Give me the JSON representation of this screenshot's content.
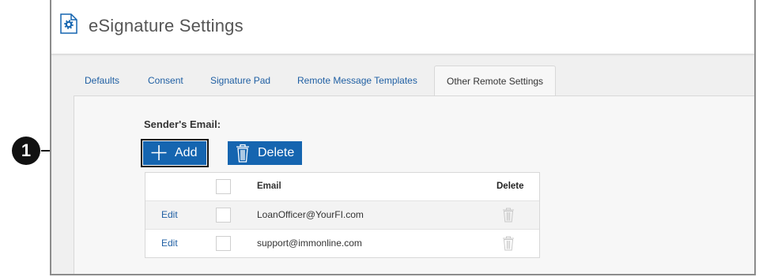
{
  "header": {
    "title": "eSignature Settings",
    "icon": "settings-document-icon"
  },
  "tabs": [
    {
      "label": "Defaults"
    },
    {
      "label": "Consent"
    },
    {
      "label": "Signature Pad"
    },
    {
      "label": "Remote Message Templates"
    },
    {
      "label": "Other Remote Settings",
      "active": true
    }
  ],
  "section": {
    "label": "Sender's Email:"
  },
  "toolbar": {
    "add_label": "Add",
    "delete_label": "Delete",
    "add_icon": "plus-icon",
    "delete_icon": "trash-icon"
  },
  "table": {
    "headers": {
      "email": "Email",
      "delete": "Delete"
    },
    "rows": [
      {
        "edit": "Edit",
        "email": "LoanOfficer@YourFI.com"
      },
      {
        "edit": "Edit",
        "email": "support@immonline.com"
      }
    ]
  },
  "callout": {
    "number": "1"
  },
  "colors": {
    "accent": "#1565b0",
    "link": "#1f5fa3"
  }
}
